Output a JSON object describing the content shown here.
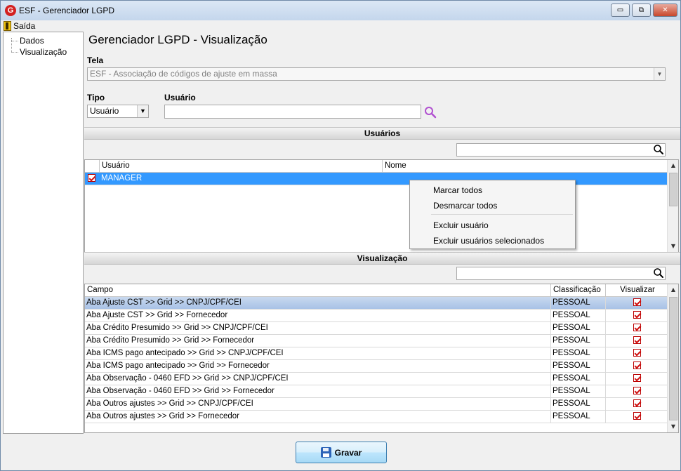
{
  "window": {
    "title": "ESF - Gerenciador LGPD",
    "app_icon_letter": "G",
    "minimize": "▭",
    "maximize": "⧉",
    "close": "✕"
  },
  "menu": {
    "exit_label": "Saída"
  },
  "tree": {
    "items": [
      "Dados",
      "Visualização"
    ]
  },
  "page": {
    "title": "Gerenciador LGPD - Visualização"
  },
  "form": {
    "tela_label": "Tela",
    "tela_value": "ESF - Associação de códigos de ajuste em massa",
    "tipo_label": "Tipo",
    "tipo_value": "Usuário",
    "usuario_label": "Usuário",
    "usuario_value": ""
  },
  "usuarios_section": {
    "title": "Usuários",
    "filter_value": "",
    "columns": [
      "Usuário",
      "Nome"
    ],
    "rows": [
      {
        "checked": true,
        "usuario": "MANAGER",
        "nome": ""
      }
    ]
  },
  "context_menu": {
    "items": [
      "Marcar todos",
      "Desmarcar todos",
      "Excluir usuário",
      "Excluir usuários selecionados"
    ]
  },
  "visualizacao_section": {
    "title": "Visualização",
    "filter_value": "",
    "columns": [
      "Campo",
      "Classificação",
      "Visualizar"
    ],
    "rows": [
      {
        "campo": "Aba Ajuste CST >> Grid >> CNPJ/CPF/CEI",
        "classificacao": "PESSOAL",
        "visualizar": true
      },
      {
        "campo": "Aba Ajuste CST >> Grid >> Fornecedor",
        "classificacao": "PESSOAL",
        "visualizar": true
      },
      {
        "campo": "Aba Crédito Presumido >> Grid >> CNPJ/CPF/CEI",
        "classificacao": "PESSOAL",
        "visualizar": true
      },
      {
        "campo": "Aba Crédito Presumido >> Grid >> Fornecedor",
        "classificacao": "PESSOAL",
        "visualizar": true
      },
      {
        "campo": "Aba ICMS pago antecipado >> Grid >> CNPJ/CPF/CEI",
        "classificacao": "PESSOAL",
        "visualizar": true
      },
      {
        "campo": "Aba ICMS pago antecipado >> Grid >> Fornecedor",
        "classificacao": "PESSOAL",
        "visualizar": true
      },
      {
        "campo": "Aba Observação - 0460 EFD >> Grid >> CNPJ/CPF/CEI",
        "classificacao": "PESSOAL",
        "visualizar": true
      },
      {
        "campo": "Aba Observação - 0460 EFD >> Grid >> Fornecedor",
        "classificacao": "PESSOAL",
        "visualizar": true
      },
      {
        "campo": "Aba Outros ajustes >> Grid >> CNPJ/CPF/CEI",
        "classificacao": "PESSOAL",
        "visualizar": true
      },
      {
        "campo": "Aba Outros ajustes >> Grid >> Fornecedor",
        "classificacao": "PESSOAL",
        "visualizar": true
      }
    ]
  },
  "footer": {
    "save_label": "Gravar"
  },
  "colors": {
    "selection": "#3399ff",
    "highlight_row": "#b7cdeb",
    "check_red": "#d01010",
    "search_icon": "#b04fd0"
  }
}
